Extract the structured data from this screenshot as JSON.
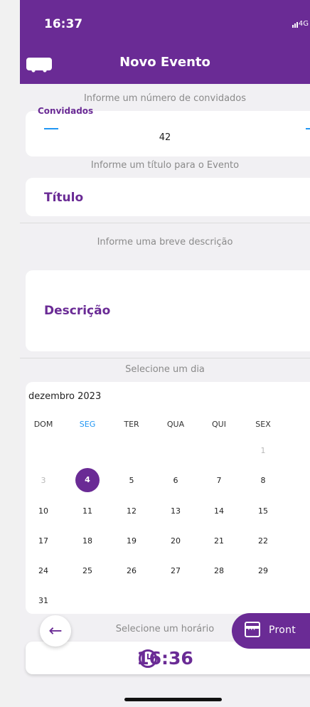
{
  "status": {
    "time": "16:37",
    "network": "4G"
  },
  "header": {
    "title": "Novo Evento"
  },
  "guests": {
    "hint": "Informe um número de convidados",
    "label": "Convidados",
    "value": "42"
  },
  "title_field": {
    "hint": "Informe um título para o Evento",
    "label": "Título"
  },
  "description_field": {
    "hint": "Informe uma breve descrição",
    "label": "Descrição"
  },
  "calendar": {
    "hint": "Selecione um dia",
    "month": "dezembro 2023",
    "weekdays": [
      "DOM",
      "SEG",
      "TER",
      "QUA",
      "QUI",
      "SEX"
    ],
    "selected_weekday": "SEG",
    "selected_day": "4",
    "rows": [
      [
        "",
        "",
        "",
        "",
        "",
        "1"
      ],
      [
        "3",
        "4",
        "5",
        "6",
        "7",
        "8"
      ],
      [
        "10",
        "11",
        "12",
        "13",
        "14",
        "15"
      ],
      [
        "17",
        "18",
        "19",
        "20",
        "21",
        "22"
      ],
      [
        "24",
        "25",
        "26",
        "27",
        "28",
        "29"
      ],
      [
        "31"
      ]
    ]
  },
  "time": {
    "hint": "Selecione um horário",
    "value": "16:36"
  },
  "buttons": {
    "ready_label": "Pront"
  },
  "colors": {
    "primary": "#6a2b95",
    "accent": "#2196f3"
  }
}
